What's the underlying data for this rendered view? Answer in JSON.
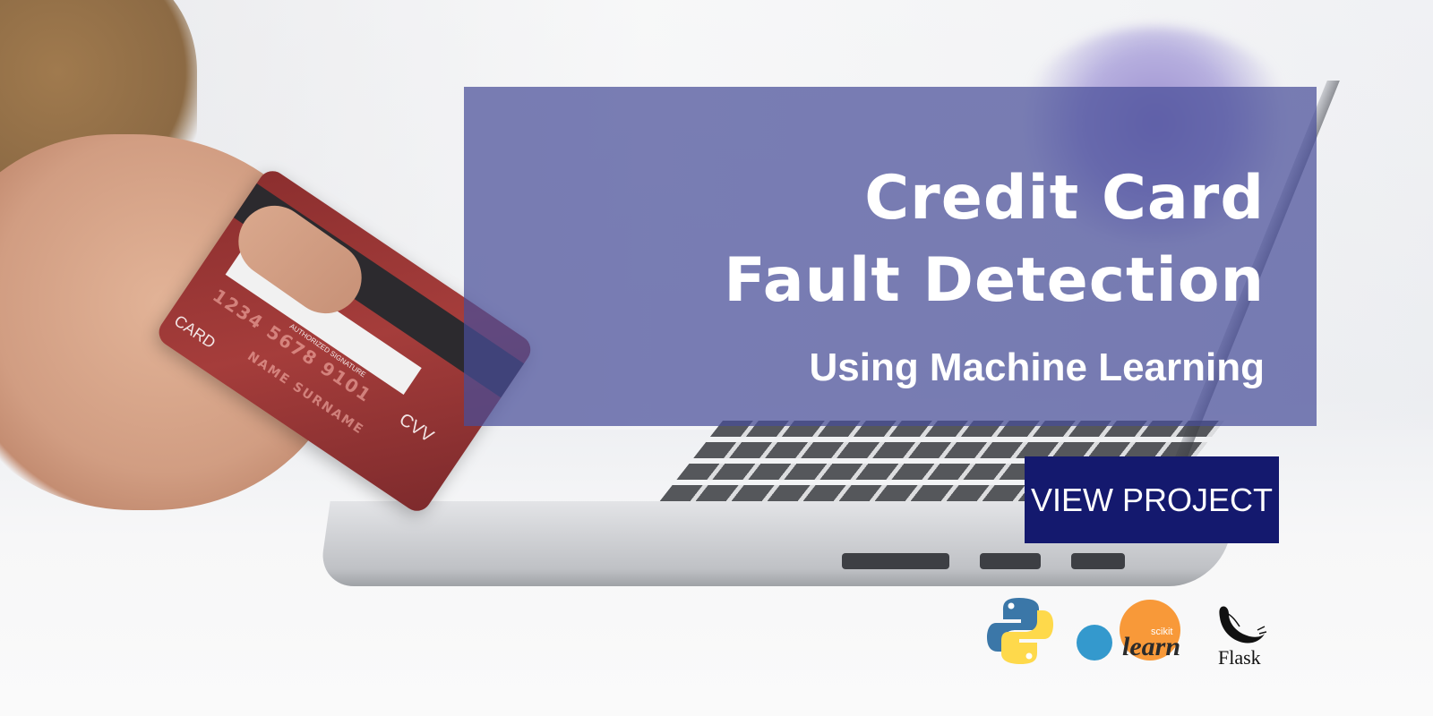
{
  "banner": {
    "title_line1": "Credit Card",
    "title_line2": "Fault Detection",
    "subtitle": "Using Machine Learning",
    "cta_label": "VIEW PROJECT"
  },
  "card": {
    "signature_label": "AUTHORIZED SIGNATURE",
    "cvv_label": "CVV",
    "card_label": "CARD",
    "embossed_line1": "1234 5678 9101",
    "embossed_line2": "NAME SURNAME"
  },
  "logos": {
    "python": "python-logo",
    "sklearn_small": "scikit",
    "sklearn_main": "learn",
    "flask": "Flask"
  },
  "colors": {
    "overlay": "#4a4e98",
    "button": "#14196e",
    "title_text": "#ffffff",
    "python_blue": "#3b77a8",
    "python_yellow": "#fed94b",
    "sklearn_orange": "#f89939",
    "sklearn_blue": "#3499cd"
  }
}
